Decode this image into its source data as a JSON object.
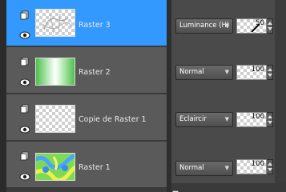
{
  "layers": [
    {
      "name": "Raster 3",
      "blend_mode": "Luminance (H)",
      "opacity": "50",
      "selected": true,
      "thumb": "sketch"
    },
    {
      "name": "Raster 2",
      "blend_mode": "Normal",
      "opacity": "100",
      "selected": false,
      "thumb": "green-gradient"
    },
    {
      "name": "Copie de Raster 1",
      "blend_mode": "Eclaircir",
      "opacity": "100",
      "selected": false,
      "thumb": "transparent"
    },
    {
      "name": "Raster 1",
      "blend_mode": "Normal",
      "opacity": "100",
      "selected": false,
      "thumb": "pattern"
    }
  ],
  "icons": {
    "layer_page": "layer-page-icon",
    "visibility": "eye-icon",
    "dropdown": "chevron-down-icon"
  },
  "colors": {
    "selected_row": "#3399ff",
    "row": "#5a5a5a"
  }
}
